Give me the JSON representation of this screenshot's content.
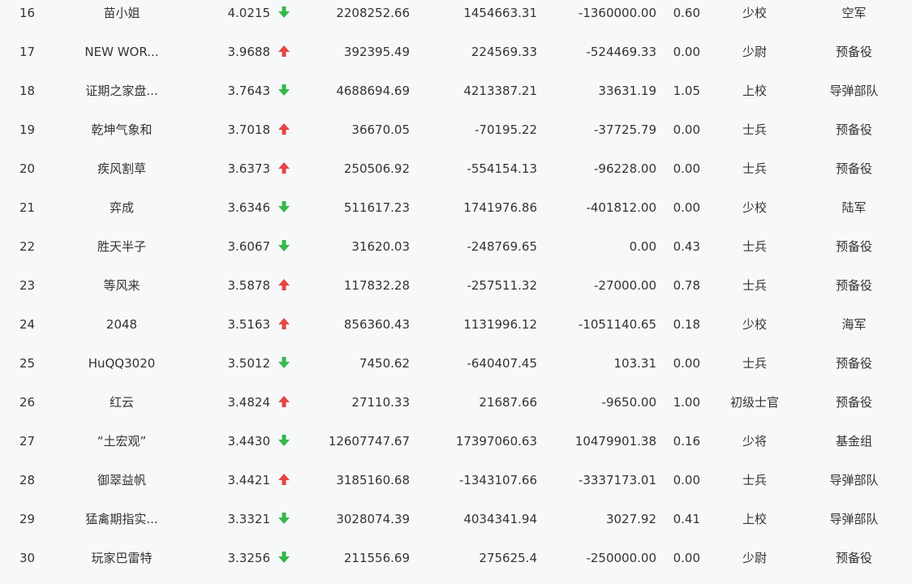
{
  "colors": {
    "up": "#e64545",
    "down": "#35b84a"
  },
  "rows": [
    {
      "rank": "16",
      "name": "苗小姐",
      "score": "4.0215",
      "trend": "down",
      "v1": "2208252.66",
      "v2": "1454663.31",
      "v3": "-1360000.00",
      "ratio": "0.60",
      "rank_title": "少校",
      "unit": "空军"
    },
    {
      "rank": "17",
      "name": "NEW WOR...",
      "score": "3.9688",
      "trend": "up",
      "v1": "392395.49",
      "v2": "224569.33",
      "v3": "-524469.33",
      "ratio": "0.00",
      "rank_title": "少尉",
      "unit": "预备役"
    },
    {
      "rank": "18",
      "name": "证期之家盘...",
      "score": "3.7643",
      "trend": "down",
      "v1": "4688694.69",
      "v2": "4213387.21",
      "v3": "33631.19",
      "ratio": "1.05",
      "rank_title": "上校",
      "unit": "导弹部队"
    },
    {
      "rank": "19",
      "name": "乾坤气象和",
      "score": "3.7018",
      "trend": "up",
      "v1": "36670.05",
      "v2": "-70195.22",
      "v3": "-37725.79",
      "ratio": "0.00",
      "rank_title": "士兵",
      "unit": "预备役"
    },
    {
      "rank": "20",
      "name": "疾风割草",
      "score": "3.6373",
      "trend": "up",
      "v1": "250506.92",
      "v2": "-554154.13",
      "v3": "-96228.00",
      "ratio": "0.00",
      "rank_title": "士兵",
      "unit": "预备役"
    },
    {
      "rank": "21",
      "name": "弈成",
      "score": "3.6346",
      "trend": "down",
      "v1": "511617.23",
      "v2": "1741976.86",
      "v3": "-401812.00",
      "ratio": "0.00",
      "rank_title": "少校",
      "unit": "陆军"
    },
    {
      "rank": "22",
      "name": "胜天半子",
      "score": "3.6067",
      "trend": "down",
      "v1": "31620.03",
      "v2": "-248769.65",
      "v3": "0.00",
      "ratio": "0.43",
      "rank_title": "士兵",
      "unit": "预备役"
    },
    {
      "rank": "23",
      "name": "等风来",
      "score": "3.5878",
      "trend": "up",
      "v1": "117832.28",
      "v2": "-257511.32",
      "v3": "-27000.00",
      "ratio": "0.78",
      "rank_title": "士兵",
      "unit": "预备役"
    },
    {
      "rank": "24",
      "name": "2048",
      "score": "3.5163",
      "trend": "up",
      "v1": "856360.43",
      "v2": "1131996.12",
      "v3": "-1051140.65",
      "ratio": "0.18",
      "rank_title": "少校",
      "unit": "海军"
    },
    {
      "rank": "25",
      "name": "HuQQ3020",
      "score": "3.5012",
      "trend": "down",
      "v1": "7450.62",
      "v2": "-640407.45",
      "v3": "103.31",
      "ratio": "0.00",
      "rank_title": "士兵",
      "unit": "预备役"
    },
    {
      "rank": "26",
      "name": "红云",
      "score": "3.4824",
      "trend": "up",
      "v1": "27110.33",
      "v2": "21687.66",
      "v3": "-9650.00",
      "ratio": "1.00",
      "rank_title": "初级士官",
      "unit": "预备役"
    },
    {
      "rank": "27",
      "name": "“土宏观”",
      "score": "3.4430",
      "trend": "down",
      "v1": "12607747.67",
      "v2": "17397060.63",
      "v3": "10479901.38",
      "ratio": "0.16",
      "rank_title": "少将",
      "unit": "基金组"
    },
    {
      "rank": "28",
      "name": "御翠益帆",
      "score": "3.4421",
      "trend": "up",
      "v1": "3185160.68",
      "v2": "-1343107.66",
      "v3": "-3337173.01",
      "ratio": "0.00",
      "rank_title": "士兵",
      "unit": "导弹部队"
    },
    {
      "rank": "29",
      "name": "猛禽期指实...",
      "score": "3.3321",
      "trend": "down",
      "v1": "3028074.39",
      "v2": "4034341.94",
      "v3": "3027.92",
      "ratio": "0.41",
      "rank_title": "上校",
      "unit": "导弹部队"
    },
    {
      "rank": "30",
      "name": "玩家巴雷特",
      "score": "3.3256",
      "trend": "down",
      "v1": "211556.69",
      "v2": "275625.4",
      "v3": "-250000.00",
      "ratio": "0.00",
      "rank_title": "少尉",
      "unit": "预备役"
    }
  ]
}
